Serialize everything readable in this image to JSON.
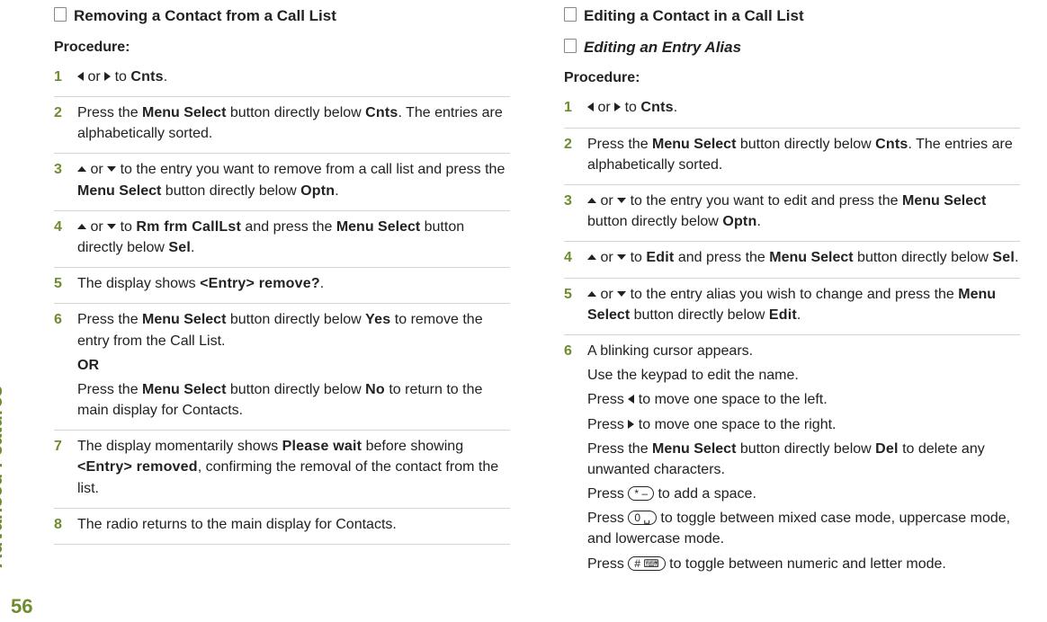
{
  "side": {
    "label": "Advanced Features",
    "page": "56"
  },
  "left": {
    "heading": "Removing a Contact from a Call List",
    "procedure_label": "Procedure:",
    "steps": {
      "s1": {
        "or": "or",
        "to": "to",
        "cnts": "Cnts",
        "period": "."
      },
      "s2a": "Press the ",
      "s2_ms": "Menu Select",
      "s2b": " button directly below ",
      "s2_cnts": "Cnts",
      "s2c": ". The entries are alphabetically sorted.",
      "s3a": " to the entry you want to remove from a call list and press the ",
      "s3_ms": "Menu Select",
      "s3b": " button directly below ",
      "s3_optn": "Optn",
      "s3c": ".",
      "s4_to": " to ",
      "s4_rm": "Rm frm CallLst",
      "s4a": " and press the ",
      "s4_ms": "Menu Select",
      "s4b": " button directly below ",
      "s4_sel": "Sel",
      "s4c": ".",
      "s5a": "The display shows ",
      "s5_msg": "<Entry> remove?",
      "s5b": ".",
      "s6a": "Press the ",
      "s6_ms": "Menu Select",
      "s6b": " button directly below ",
      "s6_yes": "Yes",
      "s6c": " to remove the entry from the Call List.",
      "s6_or": "OR",
      "s6d": "Press the ",
      "s6_ms2": "Menu Select",
      "s6e": " button directly below ",
      "s6_no": "No",
      "s6f": " to return to the main display for Contacts.",
      "s7a": "The display momentarily shows ",
      "s7_wait": "Please wait",
      "s7b": " before showing ",
      "s7_rem": "<Entry> removed",
      "s7c": ", confirming the removal of the contact from the list.",
      "s8": "The radio returns to the main display for Contacts."
    }
  },
  "right": {
    "heading": "Editing a Contact in a Call List",
    "subheading": "Editing an Entry Alias",
    "procedure_label": "Procedure:",
    "steps": {
      "s1": {
        "or": "or",
        "to": "to",
        "cnts": "Cnts",
        "period": "."
      },
      "s2a": "Press the ",
      "s2_ms": "Menu Select",
      "s2b": " button directly below ",
      "s2_cnts": "Cnts",
      "s2c": ". The entries are alphabetically sorted.",
      "s3a": " to the entry you want to edit and press the ",
      "s3_ms": "Menu Select",
      "s3b": " button directly below ",
      "s3_optn": "Optn",
      "s3c": ".",
      "s4_to": " to ",
      "s4_edit": "Edit",
      "s4a": " and press the ",
      "s4_ms": "Menu Select",
      "s4b": " button directly below ",
      "s4_sel": "Sel",
      "s4c": ".",
      "s5a": " to the entry alias you wish to change and press the ",
      "s5_ms": "Menu Select",
      "s5b": " button directly below ",
      "s5_edit": "Edit",
      "s5c": ".",
      "s6_l1": "A blinking cursor appears.",
      "s6_l2": "Use the keypad to edit the name.",
      "s6_l3a": "Press ",
      "s6_l3b": " to move one space to the left.",
      "s6_l4a": "Press ",
      "s6_l4b": " to move one space to the right.",
      "s6_l5a": "Press the ",
      "s6_ms": "Menu Select",
      "s6_l5b": " button directly below ",
      "s6_del": "Del",
      "s6_l5c": " to delete any unwanted characters.",
      "s6_l6a": "Press ",
      "s6_star": "* –",
      "s6_l6b": " to add a space.",
      "s6_l7a": "Press ",
      "s6_zero": "0 ␣",
      "s6_l7b": " to toggle between mixed case mode, uppercase mode, and lowercase mode.",
      "s6_l8a": "Press ",
      "s6_hash": "# ⌨",
      "s6_l8b": " to toggle between numeric and letter mode."
    }
  }
}
